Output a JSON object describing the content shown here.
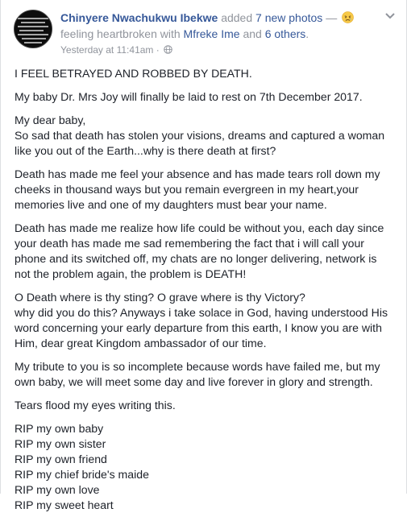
{
  "post": {
    "author": "Chinyere Nwachukwu Ibekwe",
    "action": "added",
    "photo_count": "7 new photos",
    "dash": "—",
    "feeling": "feeling heartbroken with",
    "tagged": "Mfreke Ime",
    "and": "and",
    "others": "6 others",
    "period": ".",
    "time": "Yesterday at 11:41am",
    "separator": "·",
    "icons": {
      "avatar": "profile-avatar",
      "feeling": "heartbroken-emoji-icon",
      "privacy": "globe-icon",
      "menu": "chevron-down-icon"
    }
  },
  "body": {
    "title": "I FEEL BETRAYED AND ROBBED BY DEATH.",
    "announcement": "My baby Dr. Mrs Joy will finally be laid to rest on 7th December 2017.",
    "para1_line1": "My dear baby,",
    "para1_line2": "So sad that death has stolen your visions, dreams and captured a woman",
    "para1_line3": "like you out of the Earth...why is there death at first?",
    "para2_line1": "Death has made me feel your absence and has made tears roll down my",
    "para2_line2": "cheeks in thousand ways but you remain evergreen in my heart,your",
    "para2_line3": "memories live and one of my daughters must bear your name.",
    "para3_line1": "Death has made me realize how life could be without you, each day since",
    "para3_line2": "your death has made me sad remembering the fact that i will call your",
    "para3_line3": "phone and its switched off, my chats are no longer delivering, network is",
    "para3_line4": "not the problem again, the problem is DEATH!",
    "para4_line1": "O Death where is thy sting? O grave where is thy Victory?",
    "para4_line2": "why did you do this? Anyways i take solace in God, having understood His",
    "para4_line3": "word concerning your early departure from this earth, I know you are with",
    "para4_line4": "Him, dear great Kingdom ambassador of our time.",
    "para5_line1": "My tribute to you is so incomplete because words have failed me, but my",
    "para5_line2": "own baby, we will meet some day and live forever in glory and strength.",
    "tears": "Tears flood my eyes writing this.",
    "rip1": "RIP my own baby",
    "rip2": "RIP my own sister",
    "rip3": "RIP my own friend",
    "rip4": "RIP my chief bride's maide",
    "rip5": "RIP my own love",
    "rip6": "RIP my sweet heart"
  },
  "colors": {
    "link": "#365899",
    "meta": "#90949c",
    "text": "#1d2129"
  }
}
